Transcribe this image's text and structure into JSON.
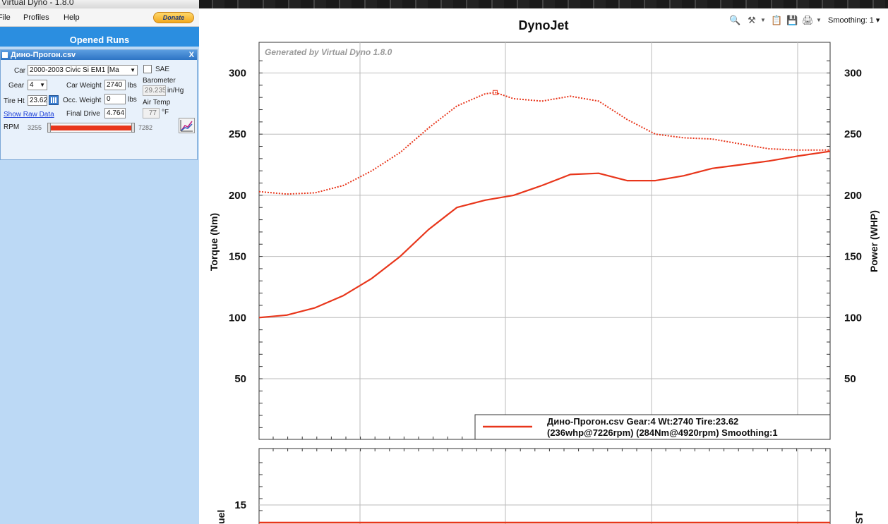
{
  "window": {
    "title": "Virtual Dyno - 1.8.0"
  },
  "menu": {
    "file": "File",
    "profiles": "Profiles",
    "help": "Help",
    "donate": "Donate"
  },
  "panel": {
    "header": "Opened Runs",
    "run": {
      "filename": "Дино-Прогон.csv",
      "close": "X",
      "car_label": "Car",
      "car_value": "2000-2003 Civic Si EM1 [Ma",
      "sae_label": "SAE",
      "gear_label": "Gear",
      "gear_value": "4",
      "car_weight_label": "Car Weight",
      "car_weight_value": "2740",
      "car_weight_unit": "lbs",
      "barometer_label": "Barometer",
      "barometer_value": "29.235",
      "barometer_unit": "in/Hg",
      "tire_label": "Tire Ht",
      "tire_value": "23.62",
      "occ_weight_label": "Occ. Weight",
      "occ_weight_value": "0",
      "occ_weight_unit": "lbs",
      "air_temp_label": "Air Temp",
      "air_temp_value": "77",
      "air_temp_unit": "°F",
      "raw_data_link": "Show Raw Data",
      "final_drive_label": "Final Drive",
      "final_drive_value": "4.764",
      "rpm_label": "RPM",
      "rpm_min": "3255",
      "rpm_max": "7282"
    }
  },
  "toolbar": {
    "smoothing": "Smoothing: 1"
  },
  "chart_data": {
    "type": "line",
    "title": "DynoJet",
    "watermark": "Generated by Virtual Dyno 1.8.0",
    "ylabel": "Torque (Nm)",
    "y2label": "Power (WHP)",
    "ylim": [
      0,
      320
    ],
    "yticks": [
      "300",
      "250",
      "200",
      "150",
      "100",
      "50"
    ],
    "grid": true,
    "legend_placement": "bottom-right",
    "legend_line1": "Дино-Прогон.csv Gear:4 Wt:2740 Tire:23.62",
    "legend_line2": "(236whp@7226rpm)  (284Nm@4920rpm)  Smoothing:1",
    "xlim": [
      3255,
      7282
    ],
    "series": [
      {
        "style": "dotted",
        "color": "#e8361b",
        "x": [
          3255,
          3450,
          3650,
          3850,
          4050,
          4250,
          4450,
          4650,
          4850,
          4920,
          5050,
          5250,
          5450,
          5650,
          5850,
          6050,
          6250,
          6450,
          6650,
          6850,
          7050,
          7226,
          7282
        ],
        "values": [
          203,
          201,
          202,
          208,
          220,
          235,
          255,
          273,
          283,
          284,
          279,
          277,
          281,
          277,
          262,
          250,
          247,
          246,
          242,
          238,
          237,
          237,
          237
        ]
      },
      {
        "style": "solid",
        "color": "#e8361b",
        "x": [
          3255,
          3450,
          3650,
          3850,
          4050,
          4250,
          4450,
          4650,
          4850,
          5050,
          5250,
          5450,
          5650,
          5850,
          6050,
          6250,
          6450,
          6650,
          6850,
          7050,
          7226,
          7282
        ],
        "values": [
          100,
          102,
          108,
          118,
          132,
          150,
          172,
          190,
          196,
          200,
          208,
          217,
          218,
          212,
          212,
          216,
          222,
          225,
          228,
          232,
          235,
          236
        ]
      }
    ],
    "sub_chart": {
      "ytick": "15",
      "ylabel": "uel",
      "y2label": "ST"
    }
  }
}
